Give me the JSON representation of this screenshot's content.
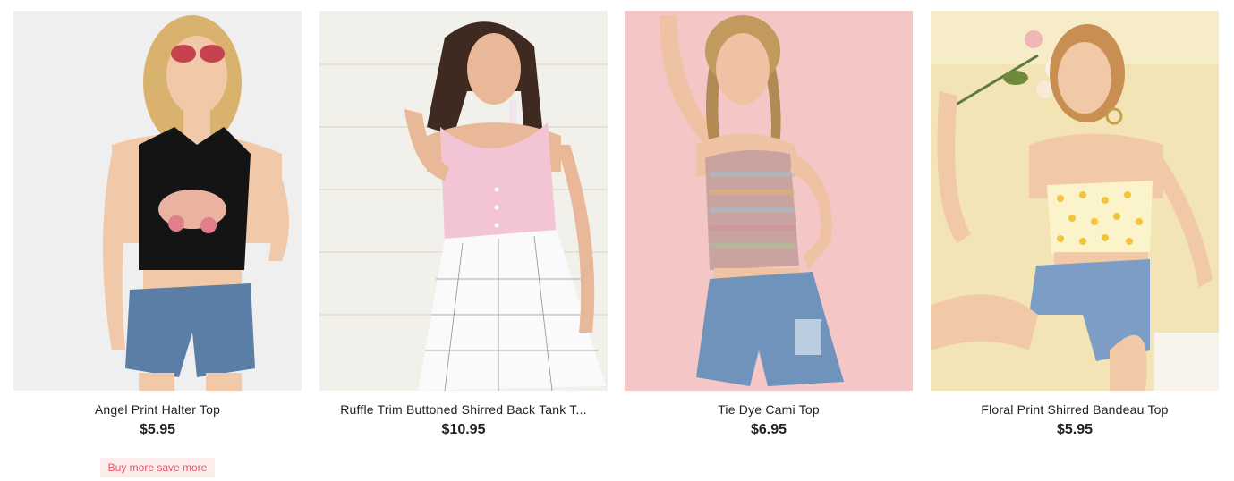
{
  "products": [
    {
      "title": "Angel Print Halter Top",
      "price": "$5.95",
      "promo": "Buy more save more"
    },
    {
      "title": "Ruffle Trim Buttoned Shirred Back Tank T...",
      "price": "$10.95"
    },
    {
      "title": "Tie Dye Cami Top",
      "price": "$6.95"
    },
    {
      "title": "Floral Print Shirred Bandeau Top",
      "price": "$5.95"
    }
  ],
  "colors": {
    "promo_bg": "#fdecec",
    "promo_text": "#e8546a",
    "card_bg_1": "#efefef",
    "card_bg_2": "#f2f0ea",
    "card_bg_3": "#f4c6c6",
    "card_bg_4": "#f2e4b4"
  }
}
